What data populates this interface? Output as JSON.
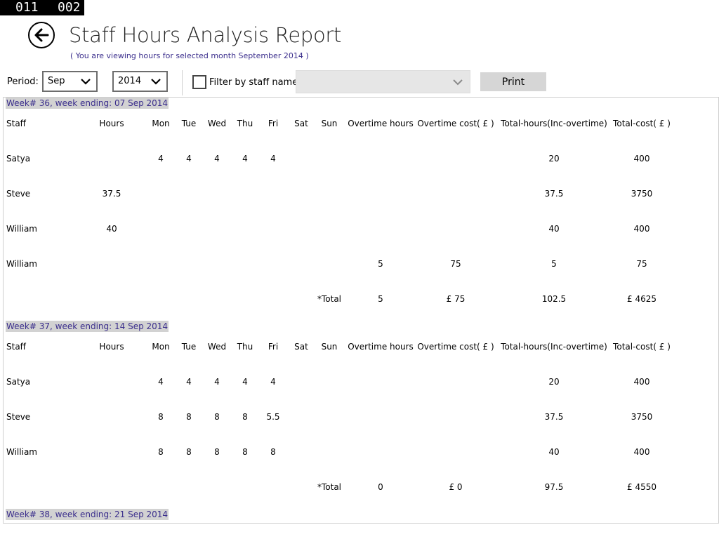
{
  "debug": {
    "left": "011",
    "right": "002"
  },
  "header": {
    "title": "Staff Hours Analysis Report",
    "subtitle": "( You are viewing hours for selected month September 2014 )"
  },
  "filters": {
    "period_label": "Period:",
    "month": "Sep",
    "year": "2014",
    "filter_label": "Filter by staff name:",
    "staff_value": "",
    "print_label": "Print"
  },
  "columns": [
    "Staff",
    "Hours",
    "Mon",
    "Tue",
    "Wed",
    "Thu",
    "Fri",
    "Sat",
    "Sun",
    "Overtime hours",
    "Overtime cost( £ )",
    "Total-hours(Inc-overtime)",
    "Total-cost( £ )"
  ],
  "weeks": [
    {
      "title": "Week# 36,  week ending: 07 Sep 2014",
      "rows": [
        [
          "Satya",
          "",
          "4",
          "4",
          "4",
          "4",
          "4",
          "",
          "",
          "",
          "",
          "20",
          "400"
        ],
        [
          "Steve",
          "37.5",
          "",
          "",
          "",
          "",
          "",
          "",
          "",
          "",
          "",
          "37.5",
          "3750"
        ],
        [
          "William",
          "40",
          "",
          "",
          "",
          "",
          "",
          "",
          "",
          "",
          "",
          "40",
          "400"
        ],
        [
          "William",
          "",
          "",
          "",
          "",
          "",
          "",
          "",
          "",
          "5",
          "75",
          "5",
          "75"
        ]
      ],
      "total": {
        "label": "*Total",
        "overtime_hours": "5",
        "overtime_cost": "£ 75",
        "total_hours": "102.5",
        "total_cost": "£ 4625"
      }
    },
    {
      "title": "Week# 37,  week ending: 14 Sep 2014",
      "rows": [
        [
          "Satya",
          "",
          "4",
          "4",
          "4",
          "4",
          "4",
          "",
          "",
          "",
          "",
          "20",
          "400"
        ],
        [
          "Steve",
          "",
          "8",
          "8",
          "8",
          "8",
          "5.5",
          "",
          "",
          "",
          "",
          "37.5",
          "3750"
        ],
        [
          "William",
          "",
          "8",
          "8",
          "8",
          "8",
          "8",
          "",
          "",
          "",
          "",
          "40",
          "400"
        ]
      ],
      "total": {
        "label": "*Total",
        "overtime_hours": "0",
        "overtime_cost": "£ 0",
        "total_hours": "97.5",
        "total_cost": "£ 4550"
      }
    },
    {
      "title": "Week# 38,  week ending: 21 Sep 2014",
      "rows": [],
      "total": null
    }
  ]
}
